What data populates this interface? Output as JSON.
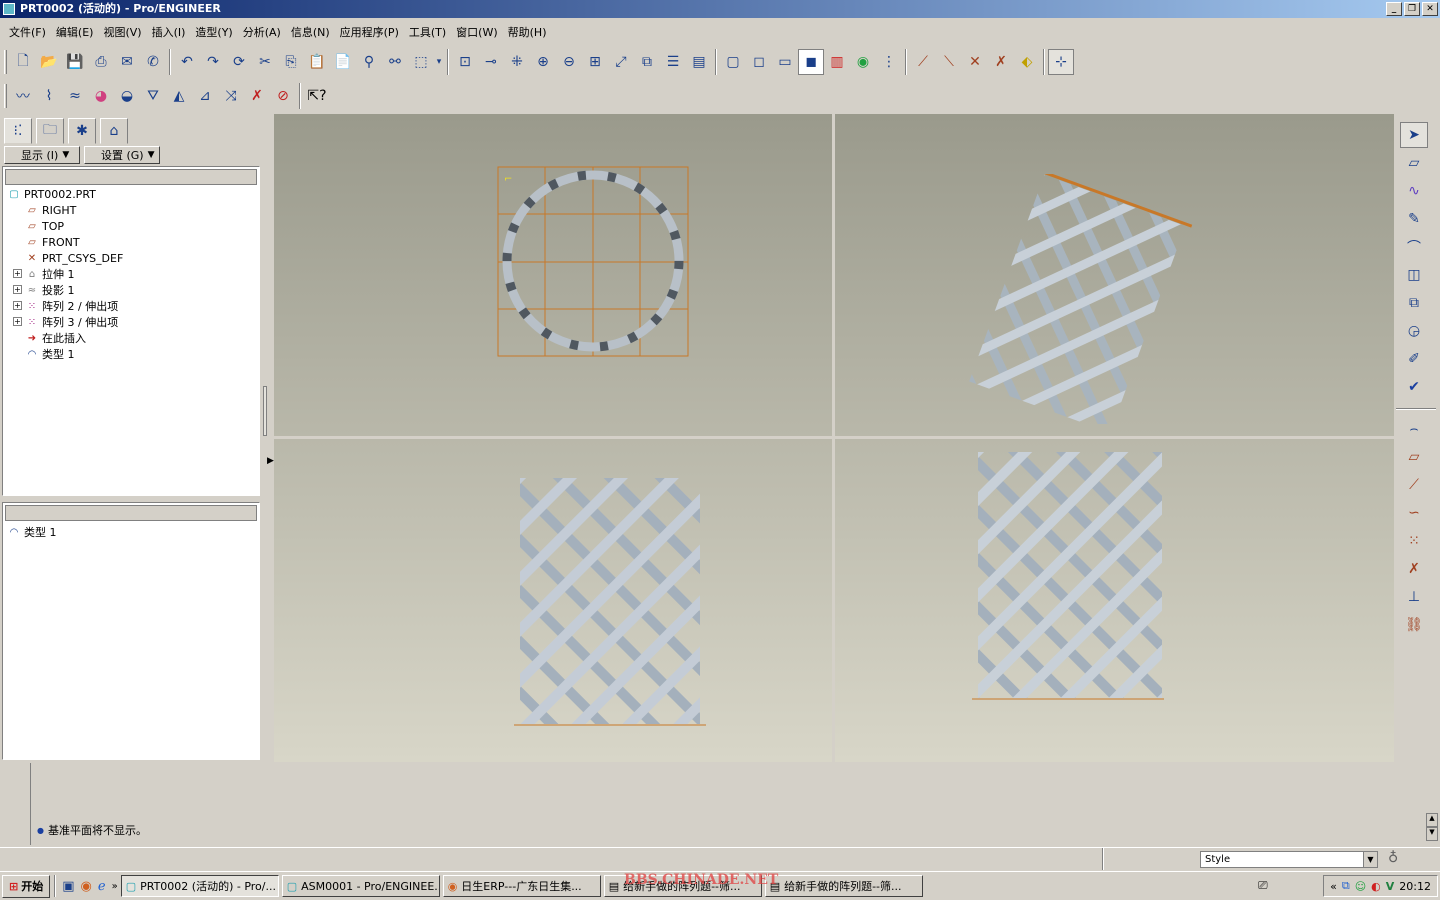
{
  "window": {
    "title": "PRT0002 (活动的) - Pro/ENGINEER"
  },
  "menu": [
    "文件(F)",
    "编辑(E)",
    "视图(V)",
    "插入(I)",
    "造型(Y)",
    "分析(A)",
    "信息(N)",
    "应用程序(P)",
    "工具(T)",
    "窗口(W)",
    "帮助(H)"
  ],
  "panel": {
    "show_label": "显示 (I)",
    "settings_label": "设置 (G)"
  },
  "tree": [
    {
      "label": "PRT0002.PRT",
      "icon": "part-icon",
      "expand": false,
      "indent": 0
    },
    {
      "label": "RIGHT",
      "icon": "datum-plane-icon",
      "expand": false,
      "indent": 1
    },
    {
      "label": "TOP",
      "icon": "datum-plane-icon",
      "expand": false,
      "indent": 1
    },
    {
      "label": "FRONT",
      "icon": "datum-plane-icon",
      "expand": false,
      "indent": 1
    },
    {
      "label": "PRT_CSYS_DEF",
      "icon": "csys-icon",
      "expand": false,
      "indent": 1
    },
    {
      "label": "拉伸 1",
      "icon": "extrude-icon",
      "expand": true,
      "indent": 1
    },
    {
      "label": "投影 1",
      "icon": "projection-icon",
      "expand": true,
      "indent": 1
    },
    {
      "label": "阵列 2 / 伸出项",
      "icon": "pattern-icon",
      "expand": true,
      "indent": 1
    },
    {
      "label": "阵列 3 / 伸出项",
      "icon": "pattern-icon",
      "expand": true,
      "indent": 1
    },
    {
      "label": "在此插入",
      "icon": "insert-here-icon",
      "expand": false,
      "indent": 1
    },
    {
      "label": "类型 1",
      "icon": "style-icon",
      "expand": false,
      "indent": 1
    }
  ],
  "style_tree": [
    {
      "label": "类型 1",
      "icon": "style-icon"
    }
  ],
  "message": "基准平面将不显示。",
  "style_select": "Style",
  "taskbar": {
    "start": "开始",
    "tasks": [
      "PRT0002 (活动的) - Pro/...",
      "ASM0001 - Pro/ENGINEE...",
      "日生ERP---广东日生集...",
      "给新手做的阵列题--筛...",
      "给新手做的阵列题--筛..."
    ],
    "clock": "20:12"
  },
  "watermark": "BBS.CHINADE.NET",
  "colors": {
    "title_start": "#0a246a",
    "title_end": "#a6caf0",
    "sketch_grid": "#c87828",
    "model": "#9aa6b0"
  }
}
